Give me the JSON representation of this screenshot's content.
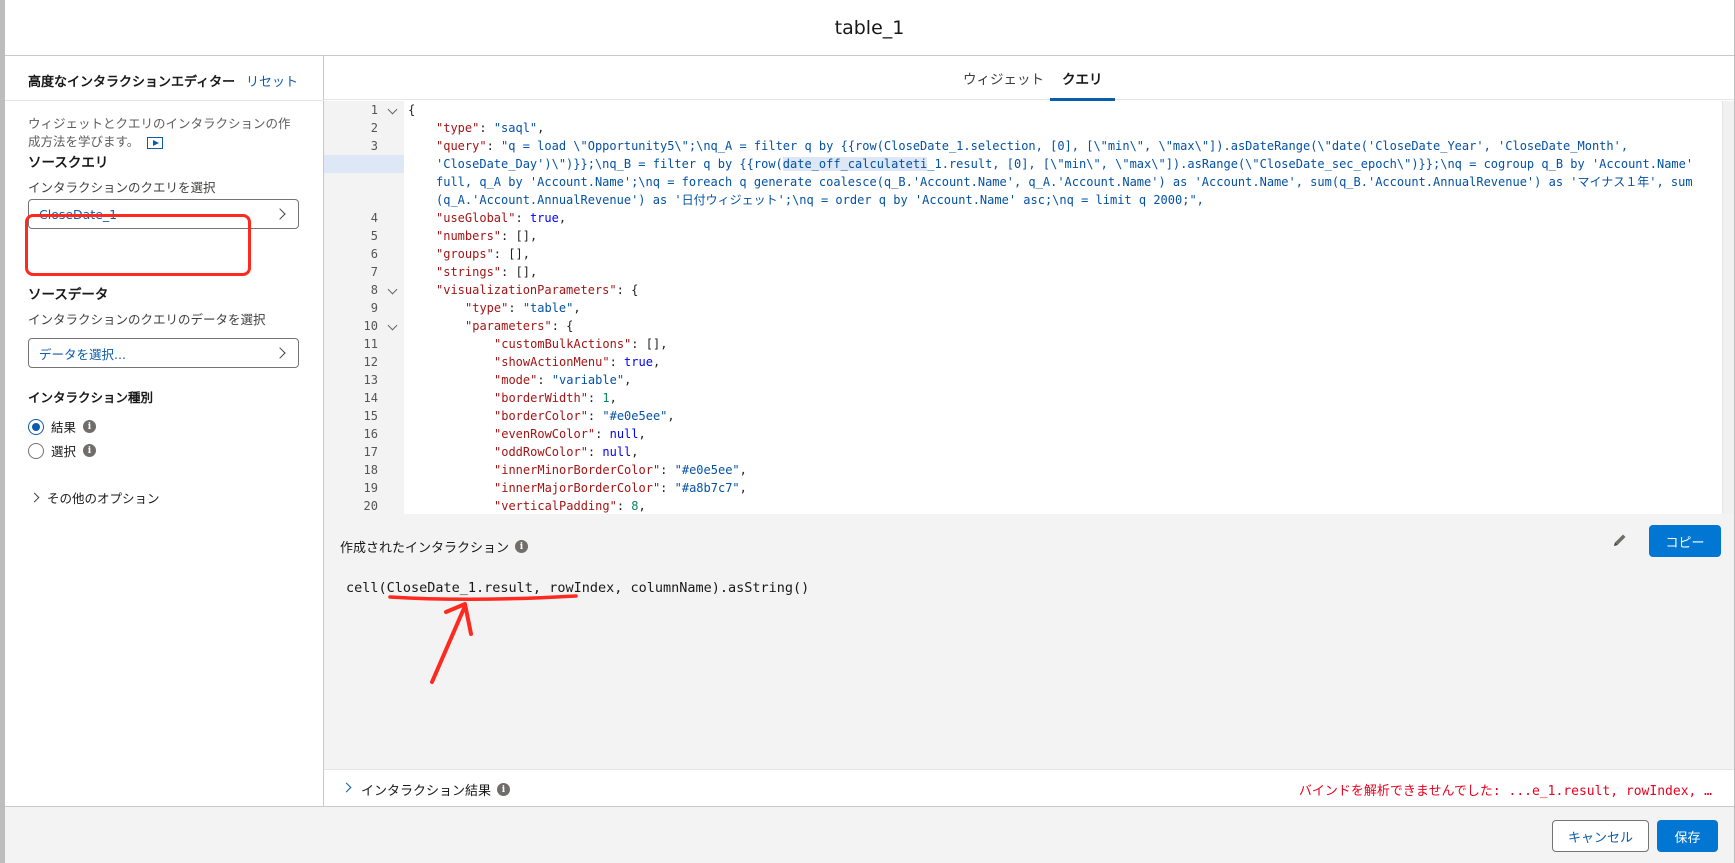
{
  "modal": {
    "title": "table_1"
  },
  "left": {
    "title": "高度なインタラクションエディター",
    "reset": "リセット",
    "help_text": "ウィジェットとクエリのインタラクションの作成方法を学びます。",
    "help_icon": "play-video-icon",
    "source_query": {
      "title": "ソースクエリ",
      "subtitle": "インタラクションのクエリを選択",
      "value": "CloseDate_1"
    },
    "source_data": {
      "title": "ソースデータ",
      "subtitle": "インタラクションのクエリのデータを選択",
      "placeholder": "データを選択..."
    },
    "interaction_type": {
      "title": "インタラクション種別",
      "options": [
        {
          "label": "結果",
          "checked": true
        },
        {
          "label": "選択",
          "checked": false
        }
      ]
    },
    "more_options": "その他のオプション"
  },
  "tabs": [
    {
      "label": "ウィジェット",
      "active": false
    },
    {
      "label": "クエリ",
      "active": true
    }
  ],
  "editor": {
    "line_numbers": [
      "1",
      "2",
      "3",
      "4",
      "5",
      "6",
      "7",
      "8",
      "9",
      "10",
      "11",
      "12",
      "13",
      "14",
      "15",
      "16",
      "17",
      "18",
      "19",
      "20"
    ],
    "lines": {
      "l1": "{",
      "l2_key": "\"type\"",
      "l2_val": "\"saql\"",
      "l3_key": "\"query\"",
      "l3_a": "\"q = load \\\"Opportunity5\\\";\\nq_A = filter q by {{row(CloseDate_1.selection, [0], [\\\"min\\\", \\\"max\\\"]).asDateRange(\\\"date('CloseDate_Year', 'CloseDate_Month',",
      "l3_b1": "'CloseDate_Day')\\\")}};\\nq_B = filter q by {{row(",
      "l3_b_sel": "date_off_calculateti",
      "l3_b2": "_1.result, [0], [\\\"min\\\", \\\"max\\\"]).asRange(\\\"CloseDate_sec_epoch\\\")}};\\nq = cogroup q_B by 'Account.Name'",
      "l3_c": "full, q_A by 'Account.Name';\\nq = foreach q generate coalesce(q_B.'Account.Name', q_A.'Account.Name') as 'Account.Name', sum(q_B.'Account.AnnualRevenue') as 'マイナス１年', sum",
      "l3_d": "(q_A.'Account.AnnualRevenue') as '日付ウィジェット';\\nq = order q by 'Account.Name' asc;\\nq = limit q 2000;\",",
      "l4_key": "\"useGlobal\"",
      "l4_val": "true",
      "l5_key": "\"numbers\"",
      "l5_val": "[]",
      "l6_key": "\"groups\"",
      "l6_val": "[]",
      "l7_key": "\"strings\"",
      "l7_val": "[]",
      "l8_key": "\"visualizationParameters\"",
      "l8_val": "{",
      "l9_key": "\"type\"",
      "l9_val": "\"table\"",
      "l10_key": "\"parameters\"",
      "l10_val": "{",
      "l11_key": "\"customBulkActions\"",
      "l11_val": "[]",
      "l12_key": "\"showActionMenu\"",
      "l12_val": "true",
      "l13_key": "\"mode\"",
      "l13_val": "\"variable\"",
      "l14_key": "\"borderWidth\"",
      "l14_val": "1",
      "l15_key": "\"borderColor\"",
      "l15_val": "\"#e0e5ee\"",
      "l16_key": "\"evenRowColor\"",
      "l16_val": "null",
      "l17_key": "\"oddRowColor\"",
      "l17_val": "null",
      "l18_key": "\"innerMinorBorderColor\"",
      "l18_val": "\"#e0e5ee\"",
      "l19_key": "\"innerMajorBorderColor\"",
      "l19_val": "\"#a8b7c7\"",
      "l20_key": "\"verticalPadding\"",
      "l20_val": "8"
    }
  },
  "interaction": {
    "title": "作成されたインタラクション",
    "copy": "コピー",
    "expression": "cell(CloseDate_1.result, rowIndex, columnName).asString()"
  },
  "result": {
    "label": "インタラクション結果",
    "error": "バインドを解析できませんでした: ...e_1.result, rowIndex, …"
  },
  "footer": {
    "cancel": "キャンセル",
    "save": "保存"
  },
  "colors": {
    "accent": "#0176d3",
    "link": "#0b5cab",
    "annotation_red": "#ff2a1f",
    "error": "#ea001e"
  }
}
